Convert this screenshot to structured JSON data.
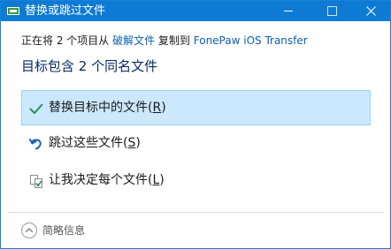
{
  "window": {
    "title": "替换或跳过文件"
  },
  "info": {
    "prefix": "正在将 2 个项目从 ",
    "source": "破解文件",
    "middle": " 复制到 ",
    "destination": "FonePaw iOS Transfer"
  },
  "heading": "目标包含 2 个同名文件",
  "options": [
    {
      "label": "替换目标中的文件(",
      "accel": "R",
      "suffix": ")",
      "icon": "checkmark-icon",
      "selected": true
    },
    {
      "label": "跳过这些文件(",
      "accel": "S",
      "suffix": ")",
      "icon": "skip-arrow-icon",
      "selected": false
    },
    {
      "label": "让我决定每个文件(",
      "accel": "L",
      "suffix": ")",
      "icon": "compare-files-icon",
      "selected": false
    }
  ],
  "details": {
    "label": "简略信息"
  },
  "colors": {
    "titlebar": "#0d7ad4",
    "selection": "#cce8ff",
    "link": "#0b5fae",
    "heading": "#0a2a63"
  }
}
